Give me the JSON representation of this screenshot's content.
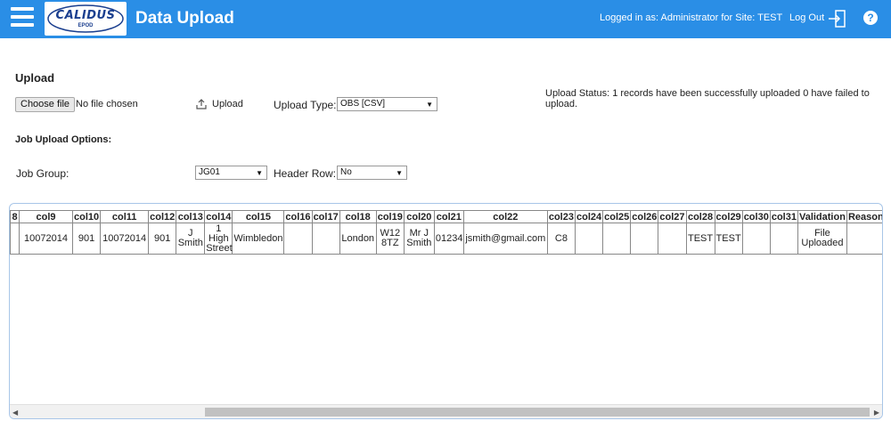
{
  "header": {
    "menu_icon": "hamburger-menu-icon",
    "logo_text": "CALIDUS",
    "logo_subtext": "EPOD",
    "title": "Data Upload",
    "logged_in_text": "Logged in as: Administrator for Site: TEST",
    "logout_label": "Log Out",
    "logout_icon": "logout-door-icon",
    "help_icon": "help-question-icon",
    "help_glyph": "?",
    "bar_color": "#2a8ee6"
  },
  "upload": {
    "section_title": "Upload",
    "choose_file_label": "Choose file",
    "no_file_text": "No file chosen",
    "upload_button_label": "Upload",
    "upload_type_label": "Upload Type:",
    "upload_type_value": "OBS [CSV]",
    "status_text": "Upload Status: 1 records have been successfully uploaded 0 have failed to upload."
  },
  "options": {
    "title": "Job Upload Options:",
    "job_group_label": "Job Group:",
    "job_group_value": "JG01",
    "header_row_label": "Header Row:",
    "header_row_value": "No"
  },
  "grid": {
    "columns": [
      "8",
      "col9",
      "col10",
      "col11",
      "col12",
      "col13",
      "col14",
      "col15",
      "col16",
      "col17",
      "col18",
      "col19",
      "col20",
      "col21",
      "col22",
      "col23",
      "col24",
      "col25",
      "col26",
      "col27",
      "col28",
      "col29",
      "col30",
      "col31",
      "Validation",
      "Reason for Failure"
    ],
    "rows": [
      [
        "",
        "10072014",
        "901",
        "10072014",
        "901",
        "J Smith",
        "1 High Street",
        "Wimbledon",
        "",
        "",
        "London",
        "W12 8TZ",
        "Mr J Smith",
        "01234",
        "jsmith@gmail.com",
        "C8",
        "",
        "",
        "",
        "",
        "TEST",
        "TEST",
        "",
        "",
        "File Uploaded",
        ""
      ]
    ]
  }
}
